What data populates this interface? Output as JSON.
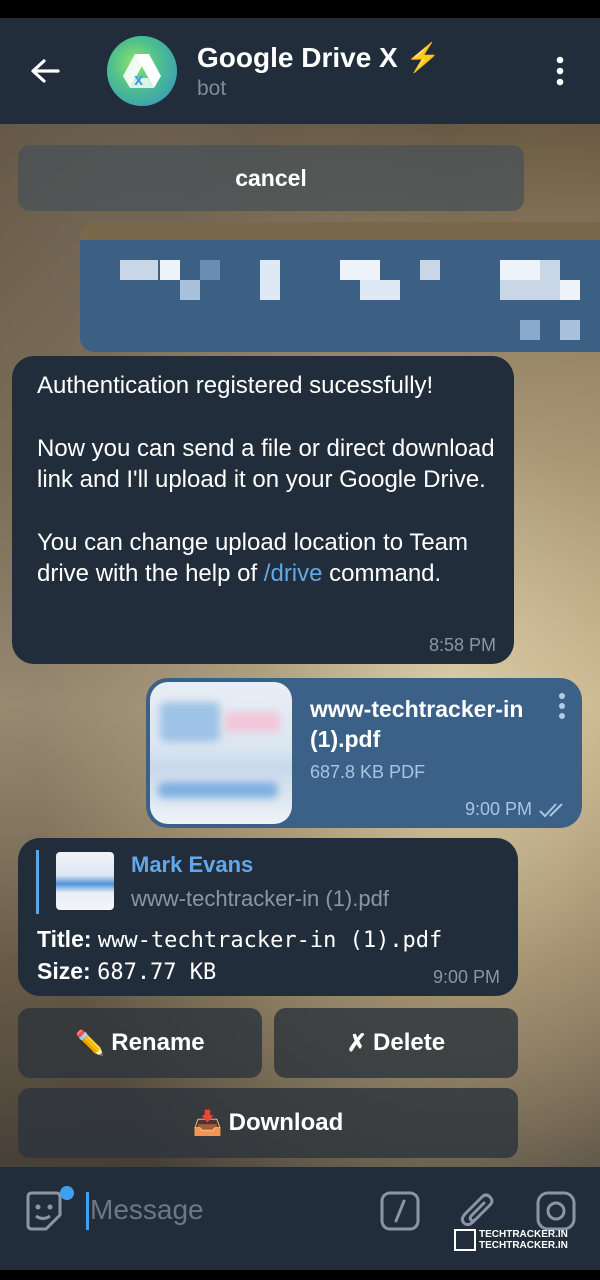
{
  "header": {
    "title": "Google Drive X",
    "title_emoji": "⚡",
    "subtitle": "bot"
  },
  "top_keyboard": {
    "cancel_label": "cancel"
  },
  "messages": {
    "auth": {
      "line1": "Authentication registered sucessfully!",
      "para2": "Now you can send a file or direct download link and I'll upload it on your Google Drive.",
      "para3_pre": "You can change upload location to Team drive with the help of ",
      "para3_link": "/drive",
      "para3_post": " command.",
      "time": "8:58 PM"
    },
    "file": {
      "name_line1": "www-techtracker-in",
      "name_line2": "(1).pdf",
      "meta": "687.8 KB PDF",
      "time": "9:00 PM"
    },
    "reply": {
      "quote_author": "Mark Evans",
      "quote_text": "www-techtracker-in (1).pdf",
      "title_label": "Title:",
      "title_value": "www-techtracker-in (1).pdf",
      "size_label": "Size:",
      "size_value": "687.77 KB",
      "time": "9:00 PM"
    }
  },
  "inline_keyboard": {
    "rename_emoji": "✏️",
    "rename_label": "Rename",
    "delete_emoji": "✗",
    "delete_label": "Delete",
    "download_emoji": "📥",
    "download_label": "Download"
  },
  "composer": {
    "placeholder": "Message",
    "icons": [
      "sticker-icon",
      "bot-command-icon",
      "attach-icon",
      "camera-icon"
    ]
  },
  "watermark": {
    "line1": "TECHTRACKER.IN",
    "line2": "TECHTRACKER.IN"
  },
  "colors": {
    "header_bg": "#212d3b",
    "incoming_bubble": "#212d3b",
    "outgoing_bubble": "#3b6188",
    "link": "#62a8e8",
    "accent_dot": "#3fa0ef"
  }
}
